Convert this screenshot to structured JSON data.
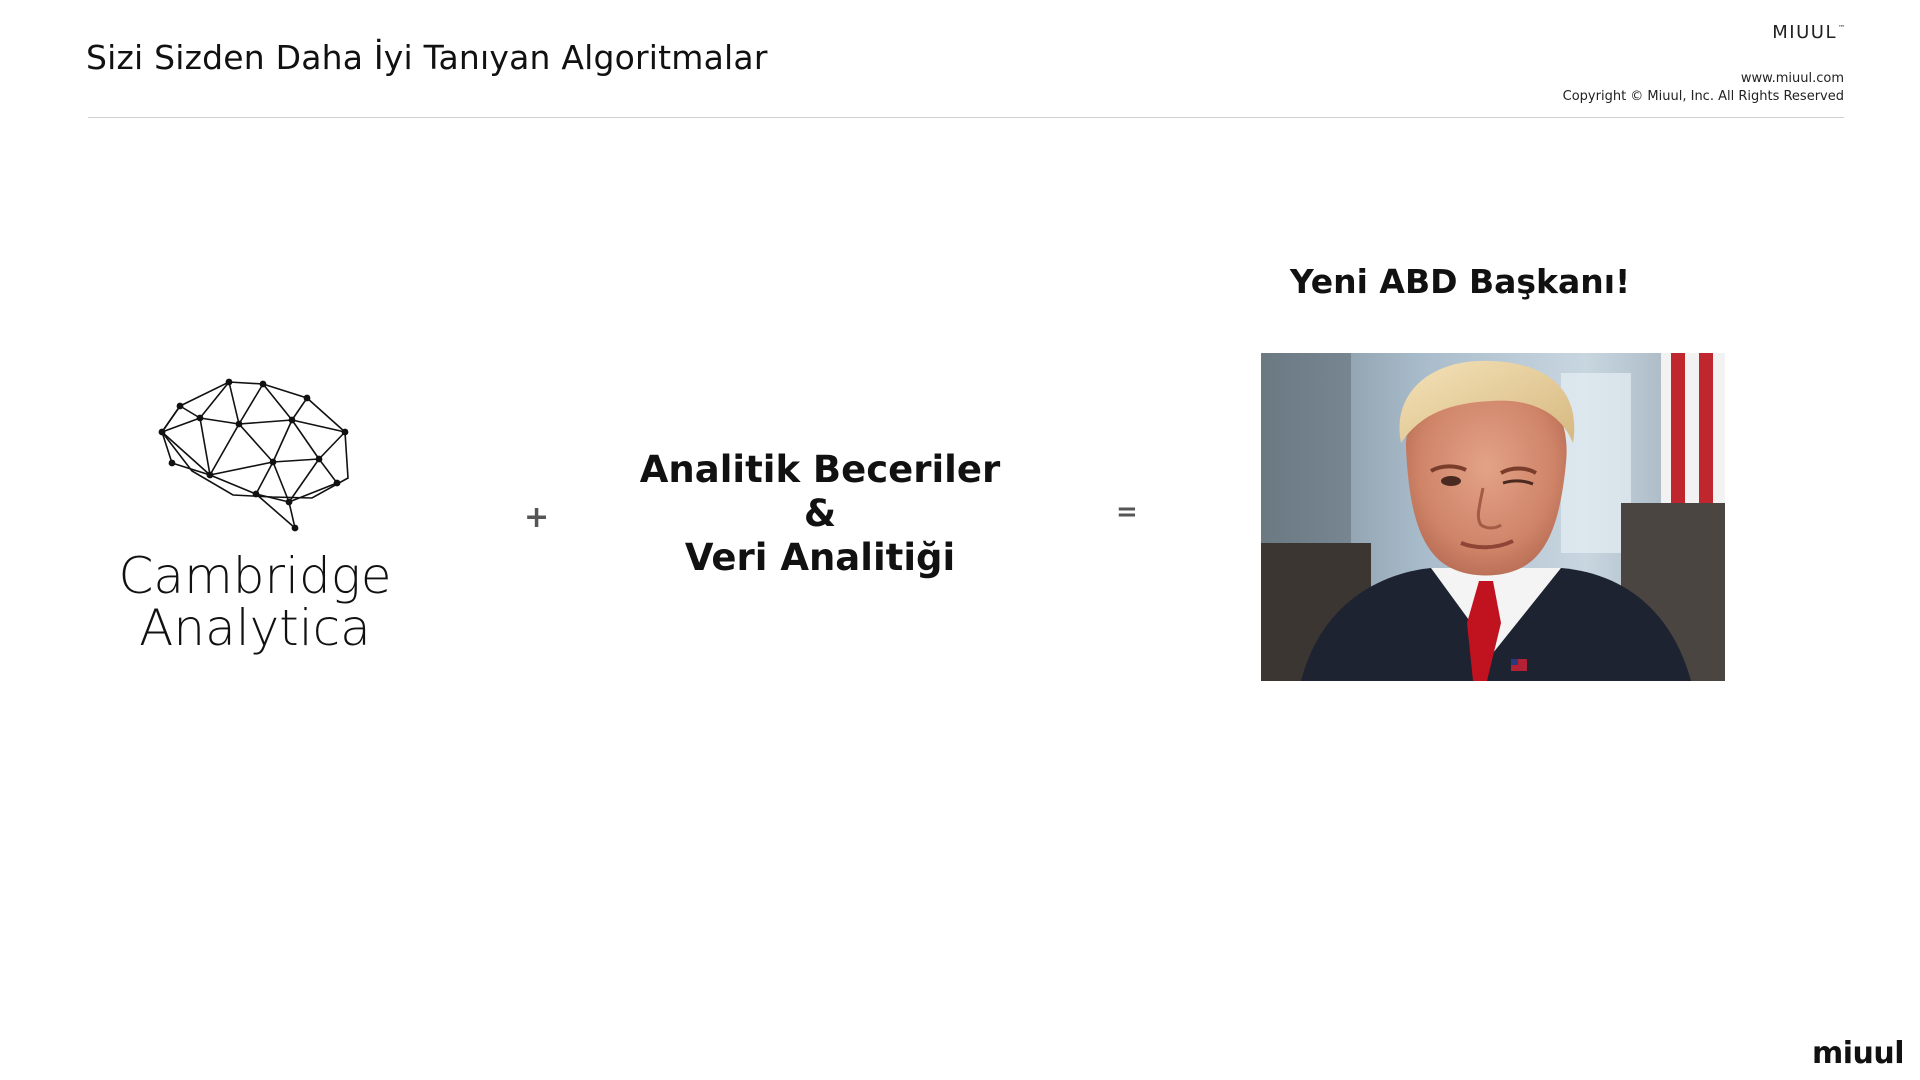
{
  "slide": {
    "title": "Sizi Sizden Daha İyi Tanıyan Algoritmalar"
  },
  "header": {
    "brand": "MIUUL",
    "trademark": "™",
    "website": "www.miuul.com",
    "copyright": "Copyright © Miuul, Inc. All Rights Reserved"
  },
  "equation": {
    "logo_line1": "Cambridge",
    "logo_line2": "Analytica",
    "plus": "+",
    "skills_line1": "Analitik Beceriler",
    "skills_line2": "&",
    "skills_line3": "Veri Analitiği",
    "equals": "=",
    "result_title": "Yeni ABD Başkanı!"
  },
  "footer": {
    "brand": "miuul"
  },
  "icons": {
    "brain": "brain-network-icon",
    "photo": "portrait-photo"
  },
  "colors": {
    "text": "#111111",
    "divider": "#d0d0d0",
    "operator": "#555555"
  }
}
